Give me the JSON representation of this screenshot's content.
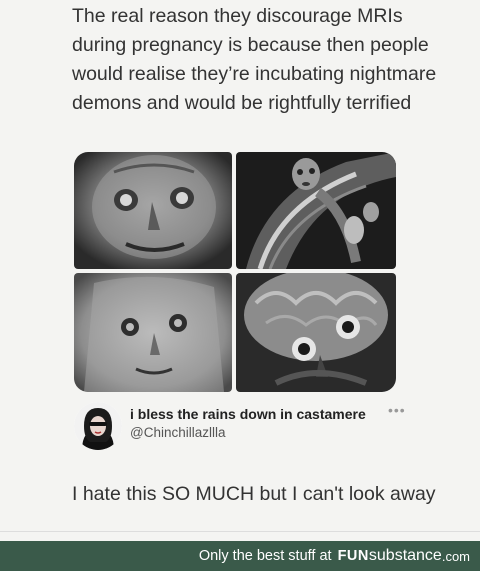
{
  "post": {
    "text": "The real reason they discourage MRIs during pregnancy is because then people would realise they’re incubating nightmare demons and would be rightfully terrified"
  },
  "reply": {
    "display_name": "i bless the rains down in castamere",
    "handle": "@Chinchillazllla",
    "more_icon": "•••",
    "text": "I hate this SO MUCH but I can't look away"
  },
  "footer": {
    "tagline": "Only the best stuff at",
    "brand_bold": "FUN",
    "brand_light": "substance",
    "brand_tld": ".com"
  },
  "colors": {
    "footer_bg": "#3a5a4a",
    "page_bg": "#f4f4f2"
  }
}
